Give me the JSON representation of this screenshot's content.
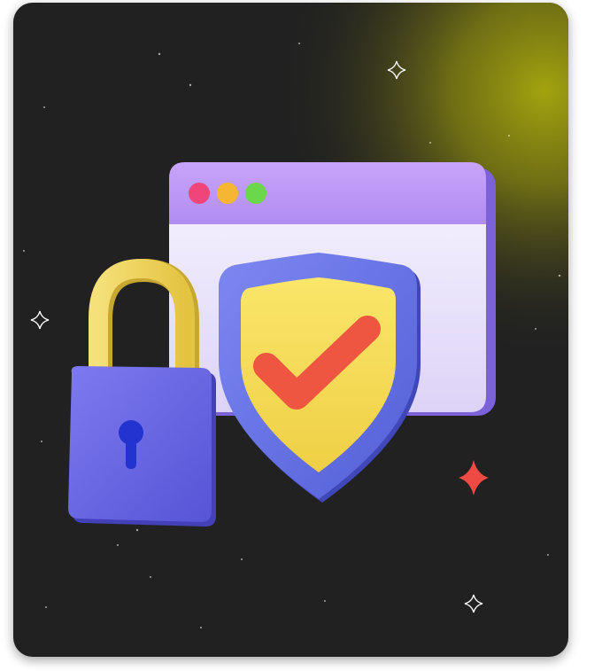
{
  "illustration": {
    "browser_window_dots": [
      {
        "name": "close-dot",
        "color": "#f0457a"
      },
      {
        "name": "minimize-dot",
        "color": "#f5b731"
      },
      {
        "name": "maximize-dot",
        "color": "#6ad84a"
      }
    ],
    "colors": {
      "background": "#212121",
      "glow": "#a3a30f",
      "window_header": "#bd97f5",
      "window_body": "#eeeafb",
      "shield_outer": "#6d78ec",
      "shield_inner": "#f6dd55",
      "checkmark": "#ee5642",
      "padlock_body": "#6e6be8",
      "padlock_shackle": "#f1d863",
      "keyhole": "#2333d0",
      "red_sparkle": "#f04a45"
    },
    "icons": [
      "browser-window-icon",
      "shield-icon",
      "checkmark-icon",
      "padlock-icon",
      "keyhole-icon",
      "sparkle-icon"
    ]
  }
}
